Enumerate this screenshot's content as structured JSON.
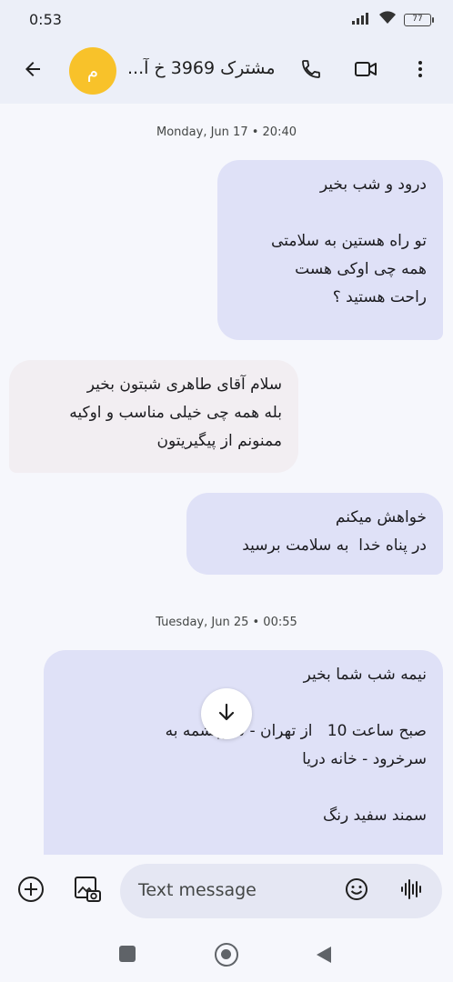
{
  "status_bar": {
    "time": "0:53",
    "battery": "77",
    "icons": [
      "signal-icon",
      "wifi-icon",
      "battery-icon"
    ]
  },
  "header": {
    "avatar_letter": "م",
    "contact_name": "مشترک 3969 خ آ...",
    "icons": [
      "back-arrow-icon",
      "phone-icon",
      "video-camera-icon",
      "more-vert-icon"
    ]
  },
  "conversation": {
    "timestamps": [
      "Monday, Jun 17 • 20:40",
      "Tuesday, Jun 25 • 00:55"
    ],
    "messages": [
      {
        "direction": "outgoing",
        "text": "درود و شب بخیر\n\nتو راه هستین به سلامتی\nهمه چی اوکی هست\nراحت هستید ؟"
      },
      {
        "direction": "incoming",
        "text": "سلام آقای طاهری شبتون بخیر\nبله همه چی خیلی مناسب و اوکیه\nممنونم از پیگیریتون"
      },
      {
        "direction": "outgoing",
        "text": "خواهش میکنم\nدر پناه خدا  به سلامت برسید"
      },
      {
        "direction": "outgoing",
        "text": "نیمه شب شما بخیر\n\nصبح ساعت 10   از تهران - سرچشمه به\nسرخرود - خانه دریا\n\nسمند سفید رنگ"
      }
    ]
  },
  "compose": {
    "placeholder": "Text message",
    "icons": [
      "add-circle-icon",
      "gallery-icon",
      "emoji-icon",
      "voice-icon"
    ]
  },
  "colors": {
    "app_bar": "#eceff8",
    "background": "#f6f7fc",
    "outgoing_bubble": "#dfe1f7",
    "incoming_bubble": "#f2eef2",
    "avatar": "#f8c22a",
    "compose_field": "#e5e7f3"
  }
}
